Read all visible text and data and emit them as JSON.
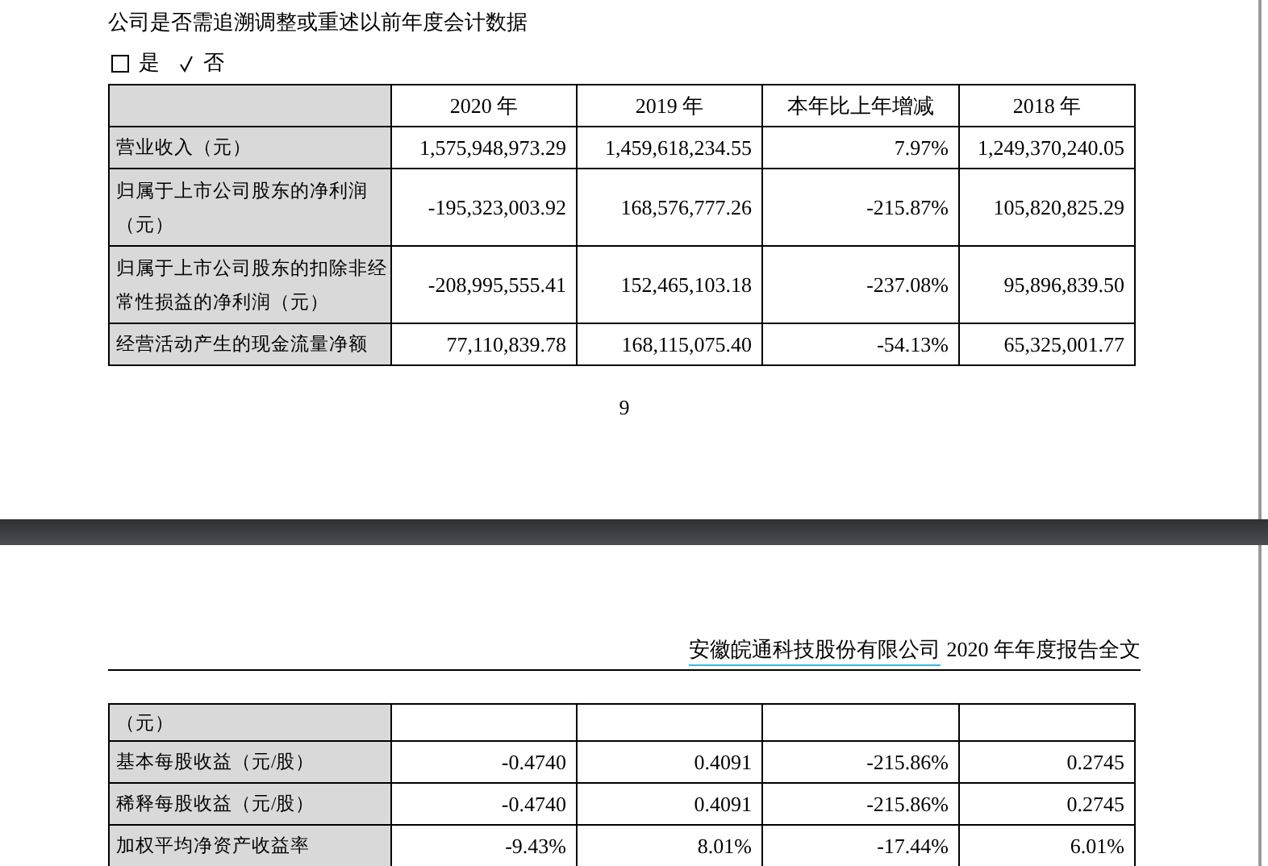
{
  "page_1": {
    "question": "公司是否需追溯调整或重述以前年度会计数据",
    "options": [
      {
        "label": "是",
        "selected": false
      },
      {
        "label": "否",
        "selected": true
      }
    ],
    "table": {
      "columns": [
        "2020 年",
        "2019 年",
        "本年比上年增减",
        "2018 年"
      ],
      "rows": [
        {
          "label": "营业收入（元）",
          "values": [
            "1,575,948,973.29",
            "1,459,618,234.55",
            "7.97%",
            "1,249,370,240.05"
          ]
        },
        {
          "label": "归属于上市公司股东的净利润（元）",
          "values": [
            "-195,323,003.92",
            "168,576,777.26",
            "-215.87%",
            "105,820,825.29"
          ]
        },
        {
          "label": "归属于上市公司股东的扣除非经常性损益的净利润（元）",
          "values": [
            "-208,995,555.41",
            "152,465,103.18",
            "-237.08%",
            "95,896,839.50"
          ]
        },
        {
          "label": "经营活动产生的现金流量净额",
          "values": [
            "77,110,839.78",
            "168,115,075.40",
            "-54.13%",
            "65,325,001.77"
          ]
        }
      ]
    },
    "page_number": "9"
  },
  "page_2": {
    "header": {
      "company": "安徽皖通科技股份有限公司",
      "title": "2020 年年度报告全文"
    },
    "table": {
      "rows": [
        {
          "label": "（元）"
        },
        {
          "label": "基本每股收益（元/股）",
          "values": [
            "-0.4740",
            "0.4091",
            "-215.86%",
            "0.2745"
          ]
        },
        {
          "label": "稀释每股收益（元/股）",
          "values": [
            "-0.4740",
            "0.4091",
            "-215.86%",
            "0.2745"
          ]
        },
        {
          "label": "加权平均净资产收益率",
          "values": [
            "-9.43%",
            "8.01%",
            "-17.44%",
            "6.01%"
          ]
        }
      ]
    }
  }
}
